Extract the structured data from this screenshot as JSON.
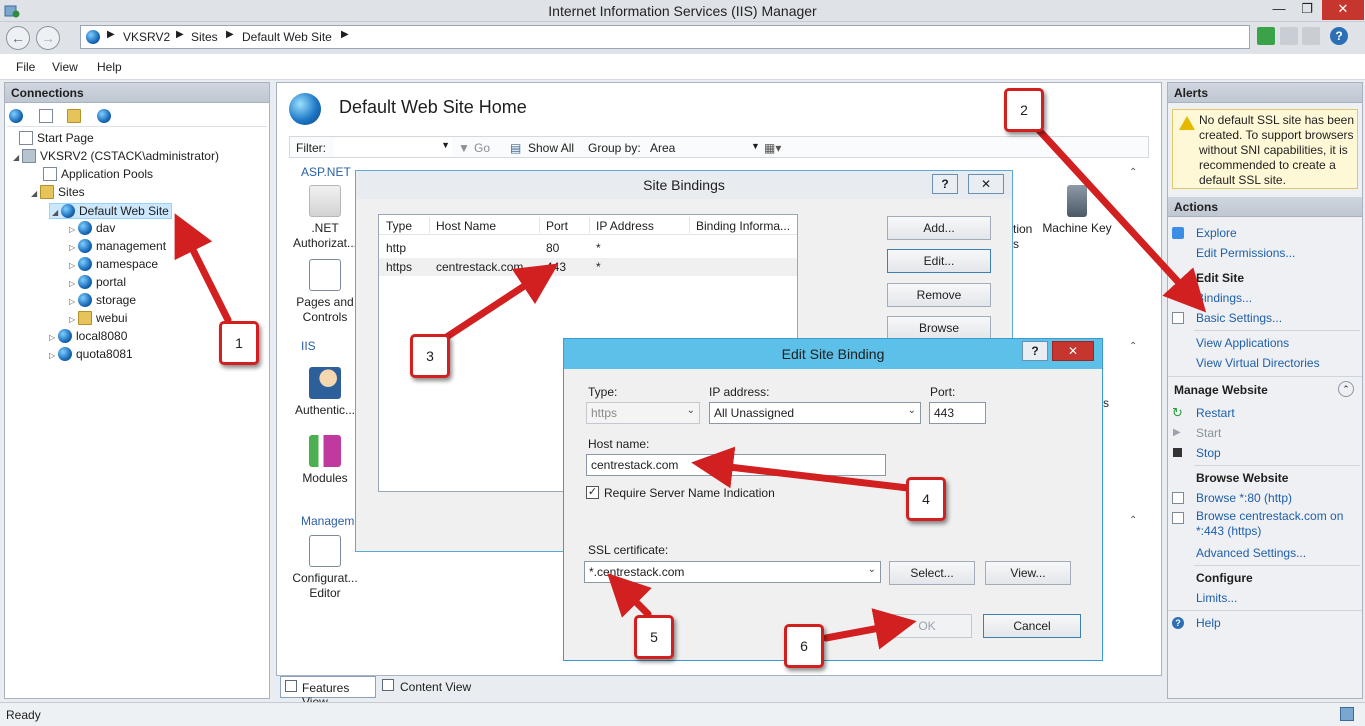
{
  "window": {
    "title": "Internet Information Services (IIS) Manager"
  },
  "address": {
    "segments": [
      "VKSRV2",
      "Sites",
      "Default Web Site"
    ]
  },
  "menu": [
    "File",
    "View",
    "Help"
  ],
  "connections": {
    "title": "Connections",
    "tree": {
      "start_page": "Start Page",
      "server": "VKSRV2 (CSTACK\\administrator)",
      "app_pools": "Application Pools",
      "sites": "Sites",
      "default_site": "Default Web Site",
      "children": [
        "dav",
        "management",
        "namespace",
        "portal",
        "storage",
        "webui"
      ],
      "other_sites": [
        "local8080",
        "quota8081"
      ]
    }
  },
  "center": {
    "title": "Default Web Site Home",
    "filter_label": "Filter:",
    "go_label": "Go",
    "show_all_label": "Show All",
    "group_by_label": "Group by:",
    "group_by_value": "Area",
    "sections": {
      "aspnet": "ASP.NET",
      "iis": "IIS",
      "management": "Managem"
    },
    "features": {
      "net_authorization": ".NET\nAuthorizat...",
      "pages_controls": "Pages and\nControls",
      "authentication": "Authentic...",
      "modules": "Modules",
      "config_editor": "Configurat...\nEditor",
      "machine_key": "Machine Key",
      "partial_ation": "tion",
      "partial_s": "s",
      "partial_s2": "s"
    }
  },
  "site_bindings": {
    "title": "Site Bindings",
    "columns": [
      "Type",
      "Host Name",
      "Port",
      "IP Address",
      "Binding Informa..."
    ],
    "rows": [
      {
        "type": "http",
        "host": "",
        "port": "80",
        "ip": "*"
      },
      {
        "type": "https",
        "host": "centrestack.com",
        "port": "443",
        "ip": "*"
      }
    ],
    "buttons": {
      "add": "Add...",
      "edit": "Edit...",
      "remove": "Remove",
      "browse": "Browse"
    }
  },
  "edit_binding": {
    "title": "Edit Site Binding",
    "type_label": "Type:",
    "type_value": "https",
    "ip_label": "IP address:",
    "ip_value": "All Unassigned",
    "port_label": "Port:",
    "port_value": "443",
    "host_label": "Host name:",
    "host_value": "centrestack.com",
    "sni_label": "Require Server Name Indication",
    "sni_checked": true,
    "ssl_label": "SSL certificate:",
    "ssl_value": "*.centrestack.com",
    "select_label": "Select...",
    "view_label": "View...",
    "ok_label": "OK",
    "cancel_label": "Cancel"
  },
  "alerts": {
    "title": "Alerts",
    "message": "No default SSL site has been created. To support browsers without SNI capabilities, it is recommended to create a default SSL site."
  },
  "actions": {
    "title": "Actions",
    "explore": "Explore",
    "edit_permissions": "Edit Permissions...",
    "edit_site_head": "Edit Site",
    "bindings": "Bindings...",
    "basic_settings": "Basic Settings...",
    "view_applications": "View Applications",
    "view_virtual_dirs": "View Virtual Directories",
    "manage_website_head": "Manage Website",
    "restart": "Restart",
    "start": "Start",
    "stop": "Stop",
    "browse_website_head": "Browse Website",
    "browse_80": "Browse *:80 (http)",
    "browse_443_a": "Browse centrestack.com on",
    "browse_443_b": "*:443 (https)",
    "advanced_settings": "Advanced Settings...",
    "configure_head": "Configure",
    "limits": "Limits...",
    "help": "Help"
  },
  "view_tabs": {
    "features": "Features View",
    "content": "Content View"
  },
  "status": {
    "text": "Ready"
  },
  "callouts": [
    "1",
    "2",
    "3",
    "4",
    "5",
    "6"
  ],
  "colors": {
    "callout_red": "#d21f1f",
    "link_blue": "#1f5fa8",
    "dialog_title": "#5cc0e8"
  }
}
